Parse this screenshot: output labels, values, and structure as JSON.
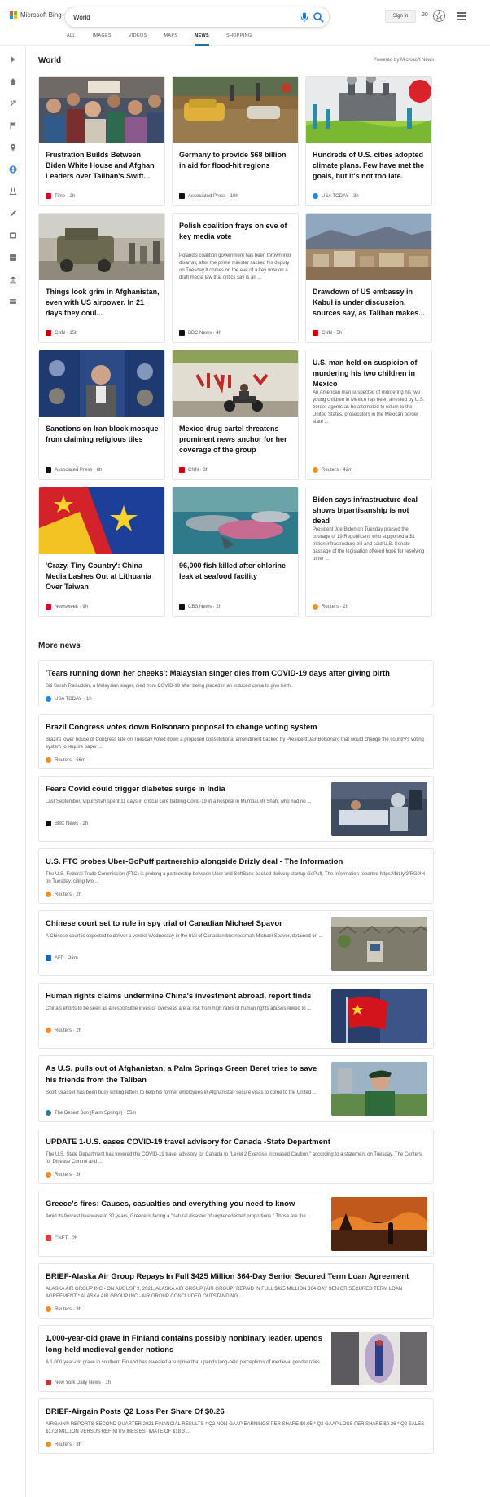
{
  "header": {
    "brand": "Microsoft Bing",
    "search_value": "World",
    "tabs": [
      "ALL",
      "IMAGES",
      "VIDEOS",
      "MAPS",
      "NEWS",
      "SHOPPING"
    ],
    "active_tab": "NEWS",
    "signin_label": "Sign in",
    "rewards_count": "20"
  },
  "sidebar": {
    "items": [
      "expand-icon",
      "home-icon",
      "recommended-icon",
      "flag-icon",
      "location-icon",
      "world-icon",
      "science-icon",
      "technology-icon",
      "entertainment-icon",
      "sports-icon",
      "money-icon",
      "politics-icon"
    ]
  },
  "world": {
    "title": "World",
    "powered_by": "Powered by Microsoft News",
    "cards": [
      {
        "title": "Frustration Builds Between Biden White House and Afghan Leaders over Taliban's Swift...",
        "source": "Time",
        "age": "2h",
        "src_color": "#e4002b"
      },
      {
        "title": "Germany to provide $68 billion in aid for flood-hit regions",
        "source": "Associated Press",
        "age": "10h",
        "src_color": "#111111"
      },
      {
        "title": "Hundreds of U.S. cities adopted climate plans. Few have met the goals, but it's not too late.",
        "source": "USA TODAY",
        "age": "3h",
        "src_color": "#1e88e5"
      },
      {
        "title": "Things look grim in Afghanistan, even with US airpower. In 21 days they coul...",
        "source": "CNN",
        "age": "15h",
        "src_color": "#cc0000"
      },
      {
        "title": "Polish coalition frays on eve of key media vote",
        "summary": "Poland's coalition government has been thrown into disarray, after the prime minister sacked his deputy on Tuesday.It comes on the eve of a key vote on a draft media law that critics say is an ...",
        "source": "BBC News",
        "age": "4h",
        "src_color": "#111111"
      },
      {
        "title": "Drawdown of US embassy in Kabul is under discussion, sources say, as Taliban makes...",
        "source": "CNN",
        "age": "5h",
        "src_color": "#cc0000"
      },
      {
        "title": "Sanctions on Iran block mosque from claiming religious tiles",
        "source": "Associated Press",
        "age": "6h",
        "src_color": "#111111"
      },
      {
        "title": "Mexico drug cartel threatens prominent news anchor for her coverage of the group",
        "source": "CNN",
        "age": "3h",
        "src_color": "#cc0000"
      },
      {
        "title": "U.S. man held on suspicion of murdering his two children in Mexico",
        "summary": "An American man suspected of murdering his two young children in Mexico has been arrested by U.S. border agents as he attempted to return to the United States, prosecutors in the Mexican border state ...",
        "source": "Reuters",
        "age": "42m",
        "src_color": "#f28c28"
      },
      {
        "title": "'Crazy, Tiny Country': China Media Lashes Out at Lithuania Over Taiwan",
        "source": "Newsweek",
        "age": "9h",
        "src_color": "#e4002b"
      },
      {
        "title": "96,000 fish killed after chlorine leak at seafood facility",
        "source": "CBS News",
        "age": "2h",
        "src_color": "#111111"
      },
      {
        "title": "Biden says infrastructure deal shows bipartisanship is not dead",
        "summary": "President Joe Biden on Tuesday praised the courage of 19 Republicans who supported a $1 trillion infrastructure bill and said U.S. Senate passage of the legislation offered hope for resolving other ...",
        "source": "Reuters",
        "age": "2h",
        "src_color": "#f28c28"
      }
    ]
  },
  "more_news": {
    "title": "More news",
    "items": [
      {
        "title": "'Tears running down her cheeks': Malaysian singer dies from COVID-19 days after giving birth",
        "summary": "Siti Sarah Raisuddin, a Malaysian singer, died from COVID-19 after being placed in an induced coma to give birth.",
        "source": "USA TODAY",
        "age": "1h",
        "src_color": "#1e88e5"
      },
      {
        "title": "Brazil Congress votes down Bolsonaro proposal to change voting system",
        "summary": "Brazil's lower house of Congress late on Tuesday voted down a proposed constitutional amendment backed by President Jair Bolsonaro that would change the country's voting system to require paper ...",
        "source": "Reuters",
        "age": "56m",
        "src_color": "#f28c28"
      },
      {
        "title": "Fears Covid could trigger diabetes surge in India",
        "summary": "Last September, Vipul Shah spent 11 days in critical care battling Covid-19 in a hospital in Mumbai.Mr Shah, who had no ...",
        "source": "BBC News",
        "age": "2h",
        "src_color": "#111111"
      },
      {
        "title": "U.S. FTC probes Uber-GoPuff partnership alongside Drizly deal - The Information",
        "summary": "The U.S. Federal Trade Commission (FTC) is probing a partnership between Uber and SoftBank-backed delivery startup GoPuff, The Information reported https://bit.ly/3fRG0IH on Tuesday, citing two ...",
        "source": "Reuters",
        "age": "2h",
        "src_color": "#f28c28"
      },
      {
        "title": "Chinese court set to rule in spy trial of Canadian Michael Spavor",
        "summary": "A Chinese court is expected to deliver a verdict Wednesday in the trial of Canadian businessman Michael Spavor, detained on ...",
        "source": "AFP",
        "age": "26m",
        "src_color": "#1565c0"
      },
      {
        "title": "Human rights claims undermine China's investment abroad, report finds",
        "summary": "China's efforts to be seen as a responsible investor overseas are at risk from high rates of human rights abuses linked to ...",
        "source": "Reuters",
        "age": "2h",
        "src_color": "#f28c28"
      },
      {
        "title": "As U.S. pulls out of Afghanistan, a Palm Springs Green Beret tries to save his friends from the Taliban",
        "summary": "Scott Grasser has been busy writing letters to help his former employees in Afghanistan secure visas to come to the United ...",
        "source": "The Desert Sun (Palm Springs)",
        "age": "55m",
        "src_color": "#2e7d9a"
      },
      {
        "title": "UPDATE 1-U.S. eases COVID-19 travel advisory for Canada -State Department",
        "summary": "The U.S. State Department has lowered the COVID-19 travel advisory for Canada to \"Level 2 Exercise Increased Caution,\" according to a statement on Tuesday. The Centers for Disease Control and ...",
        "source": "Reuters",
        "age": "3h",
        "src_color": "#f28c28"
      },
      {
        "title": "Greece's fires: Causes, casualties and everything you need to know",
        "summary": "Amid its fiercest heatwave in 30 years, Greece is facing a \"natural disaster of unprecedented proportions.\" Those are the ...",
        "source": "CNET",
        "age": "2h",
        "src_color": "#e53935"
      },
      {
        "title": "BRIEF-Alaska Air Group Repays In Full $425 Million 364-Day Senior Secured Term Loan Agreement",
        "summary": "ALASKA AIR GROUP INC - ON AUGUST 9, 2021, ALASKA AIR GROUP (AIR GROUP) REPAID IN FULL $425 MILLION 364-DAY SENIOR SECURED TERM LOAN AGREEMENT * ALASKA AIR GROUP INC - AIR GROUP CONCLUDED OUTSTANDING ...",
        "source": "Reuters",
        "age": "3h",
        "src_color": "#f28c28"
      },
      {
        "title": "1,000-year-old grave in Finland contains possibly nonbinary leader, upends long-held medieval gender notions",
        "summary": "A 1,000-year-old grave in southern Finland has revealed a surprise that upends long-held perceptions of medieval gender roles ...",
        "source": "New York Daily News",
        "age": "1h",
        "src_color": "#d32f2f"
      },
      {
        "title": "BRIEF-Airgain Posts Q2 Loss Per Share Of $0.26",
        "summary": "AIRGAIN® REPORTS SECOND QUARTER 2021 FINANCIAL RESULTS * Q2 NON-GAAP EARNINGS PER SHARE $0.05 * Q2 GAAP LOSS PER SHARE $0.26 * Q2 SALES $17.3 MILLION VERSUS REFINITIV IBES ESTIMATE OF $18.3 ...",
        "source": "Reuters",
        "age": "3h",
        "src_color": "#f28c28"
      }
    ]
  }
}
